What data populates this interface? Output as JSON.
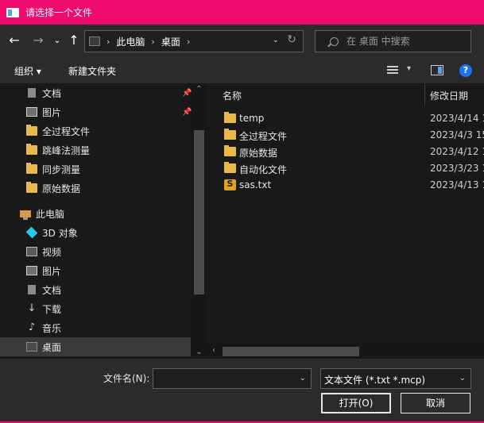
{
  "window": {
    "title": "请选择一个文件"
  },
  "nav": {
    "back": "←",
    "forward": "→",
    "recent": "⌄",
    "up": "↑",
    "breadcrumb": [
      "此电脑",
      "桌面"
    ],
    "search_placeholder": "在 桌面 中搜索"
  },
  "toolbar": {
    "organize": "组织 ▾",
    "new_folder": "新建文件夹",
    "help": "?"
  },
  "sidebar": {
    "items": [
      {
        "label": "文档",
        "icon": "document-icon",
        "pinned": true
      },
      {
        "label": "图片",
        "icon": "picture-icon",
        "pinned": true
      },
      {
        "label": "全过程文件",
        "icon": "folder-icon"
      },
      {
        "label": "跳峰法测量",
        "icon": "folder-icon"
      },
      {
        "label": "同步测量",
        "icon": "folder-icon"
      },
      {
        "label": "原始数据",
        "icon": "folder-icon"
      },
      {
        "label": "此电脑",
        "icon": "computer-icon"
      },
      {
        "label": "3D 对象",
        "icon": "3d-objects-icon"
      },
      {
        "label": "视频",
        "icon": "video-icon"
      },
      {
        "label": "图片",
        "icon": "picture-icon"
      },
      {
        "label": "文档",
        "icon": "document-icon"
      },
      {
        "label": "下载",
        "icon": "download-icon"
      },
      {
        "label": "音乐",
        "icon": "music-icon"
      },
      {
        "label": "桌面",
        "icon": "desktop-icon",
        "selected": true
      }
    ]
  },
  "files": {
    "columns": {
      "name": "名称",
      "date": "修改日期"
    },
    "rows": [
      {
        "name": "temp",
        "date": "2023/4/14 1",
        "icon": "folder-icon"
      },
      {
        "name": "全过程文件",
        "date": "2023/4/3 15",
        "icon": "folder-icon"
      },
      {
        "name": "原始数据",
        "date": "2023/4/12 1",
        "icon": "folder-icon"
      },
      {
        "name": "自动化文件",
        "date": "2023/3/23 1",
        "icon": "folder-icon"
      },
      {
        "name": "sas.txt",
        "date": "2023/4/13 1",
        "icon": "sublime-file-icon"
      }
    ]
  },
  "bottom": {
    "filename_label": "文件名(N):",
    "filename_value": "",
    "filetype": "文本文件 (*.txt *.mcp)",
    "open": "打开(O)",
    "cancel": "取消"
  },
  "colors": {
    "titlebar": "#ed0c6e",
    "folder": "#e8b84a",
    "help": "#1a73e8"
  }
}
